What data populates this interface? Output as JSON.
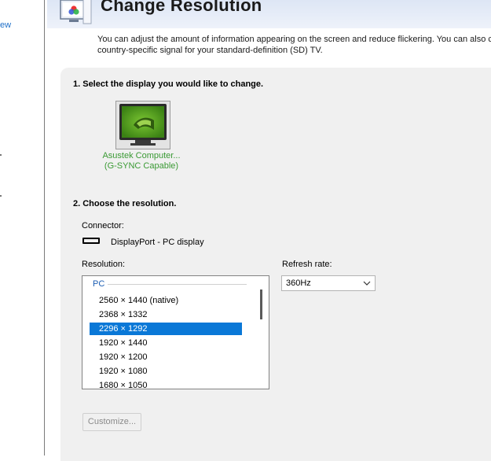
{
  "left_panel": {
    "link_fragment": "ew"
  },
  "header": {
    "title": "Change Resolution",
    "description_line1": "You can adjust the amount of information appearing on the screen and reduce flickering. You can also cho",
    "description_line2": "country-specific signal for your standard-definition (SD) TV."
  },
  "step1": {
    "title": "1. Select the display you would like to change.",
    "display": {
      "name": "Asustek Computer...",
      "subtitle": "(G-SYNC Capable)",
      "icon": "nvidia-monitor-icon"
    }
  },
  "step2": {
    "title": "2. Choose the resolution.",
    "connector_label": "Connector:",
    "connector_icon": "displayport-icon",
    "connector_value": "DisplayPort - PC display",
    "resolution_label": "Resolution:",
    "resolution_group": "PC",
    "resolutions": [
      {
        "label": "2560 × 1440 (native)",
        "selected": false
      },
      {
        "label": "2368 × 1332",
        "selected": false
      },
      {
        "label": "2296 × 1292",
        "selected": true
      },
      {
        "label": "1920 × 1440",
        "selected": false
      },
      {
        "label": "1920 × 1200",
        "selected": false
      },
      {
        "label": "1920 × 1080",
        "selected": false
      },
      {
        "label": "1680 × 1050",
        "selected": false
      }
    ],
    "refresh_label": "Refresh rate:",
    "refresh_value": "360Hz",
    "customize_label": "Customize..."
  },
  "colors": {
    "accent_selected": "#0a78d7",
    "caption_green": "#3a9a34",
    "nvidia_green": "#76b900",
    "link_blue": "#1e6fc8"
  }
}
